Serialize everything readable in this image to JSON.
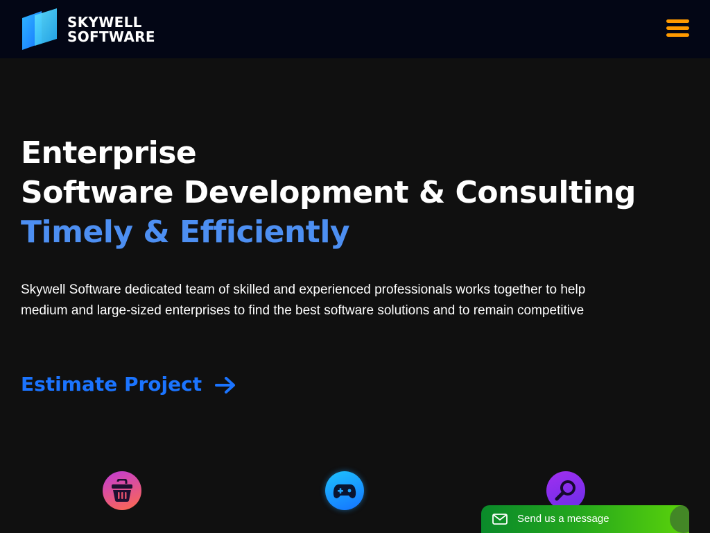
{
  "brand": {
    "line1": "SKYWELL",
    "line2": "SOFTWARE"
  },
  "header": {
    "menu_icon": "hamburger-menu-icon",
    "menu_color": "#ff9a00"
  },
  "hero": {
    "title_line1": "Enterprise",
    "title_line2": "Software Development & Consulting",
    "title_line3": "Timely & Efficiently",
    "description": "Skywell Software dedicated team of skilled and experienced professionals works together to help medium and large-sized enterprises to find the best software solutions and to remain competitive",
    "cta_label": "Estimate Project",
    "cta_icon": "arrow-right-icon"
  },
  "features": [
    {
      "icon": "shopping-basket-icon"
    },
    {
      "icon": "gamepad-icon"
    },
    {
      "icon": "magnifier-icon"
    }
  ],
  "chat": {
    "label": "Send us a message",
    "icon": "envelope-icon"
  },
  "colors": {
    "background": "#101010",
    "header": "#030615",
    "accent_blue": "#4d8ff2",
    "cta_blue": "#1b74ff",
    "chat_green": "#23a61d"
  }
}
